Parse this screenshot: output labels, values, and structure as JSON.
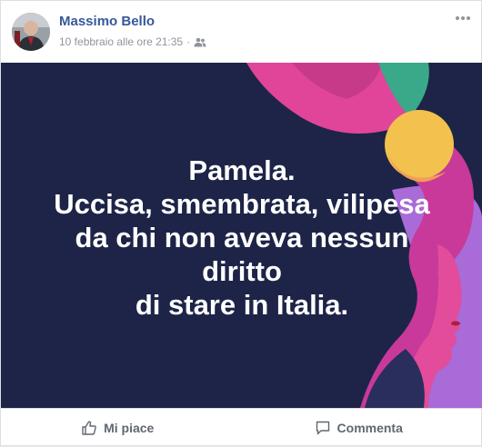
{
  "post": {
    "author": "Massimo Bello",
    "timestamp": "10 febbraio alle ore 21:35",
    "audience_icon": "friends-icon",
    "more_icon": "more-options-icon"
  },
  "image": {
    "lines": [
      "Pamela.",
      "Uccisa, smembrata, vilipesa",
      "da chi non aveva nessun",
      "diritto",
      "di stare in Italia."
    ],
    "colors": {
      "background": "#1d2447",
      "text": "#ffffff",
      "pink": "#e0459a",
      "purple": "#a86bd8",
      "yellow": "#f2c14e",
      "green": "#3aa98a"
    }
  },
  "actions": {
    "like_label": "Mi piace",
    "like_icon": "thumbs-up-icon",
    "comment_label": "Commenta",
    "comment_icon": "comment-icon"
  }
}
